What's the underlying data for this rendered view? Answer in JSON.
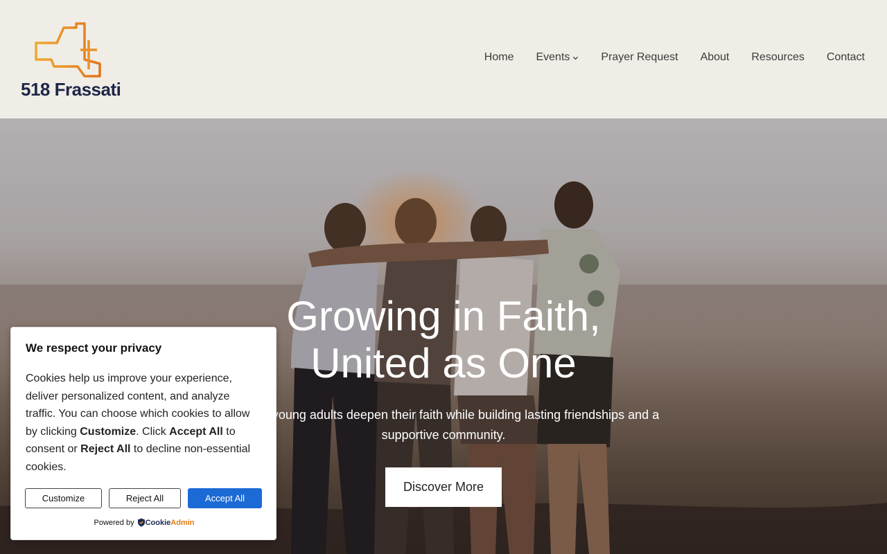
{
  "brand": {
    "name": "518 Frassati"
  },
  "nav": {
    "items": [
      {
        "label": "Home"
      },
      {
        "label": "Events"
      },
      {
        "label": "Prayer Request"
      },
      {
        "label": "About"
      },
      {
        "label": "Resources"
      },
      {
        "label": "Contact"
      }
    ]
  },
  "hero": {
    "title_line1": "Growing in Faith,",
    "title_line2": "United as One",
    "subtitle_line1": ", where young adults deepen their faith while building lasting friendships and a",
    "subtitle_line2": "supportive community.",
    "button": "Discover More"
  },
  "cookie": {
    "title": "We respect your privacy",
    "text_1": "Cookies help us improve your experience, deliver personalized content, and analyze traffic. You can choose which cookies to allow by clicking ",
    "text_customize": "Customize",
    "text_2": ". Click ",
    "text_accept": "Accept All",
    "text_3": " to consent or ",
    "text_reject": "Reject All",
    "text_4": " to decline non-essential cookies.",
    "customize_button": "Customize",
    "reject_button": "Reject All",
    "accept_button": "Accept All",
    "powered_by": "Powered by",
    "powered_brand_1": "Cookie",
    "powered_brand_2": "Admin"
  },
  "colors": {
    "header_bg": "#efede6",
    "logo_orange": "#e8922a",
    "logo_text": "#1e2548",
    "accept_blue": "#1c6ad6"
  },
  "icons": {
    "logo": "new-york-state-cross-logo",
    "events_dropdown": "chevron-down-icon",
    "cookieadmin": "shield-icon"
  }
}
